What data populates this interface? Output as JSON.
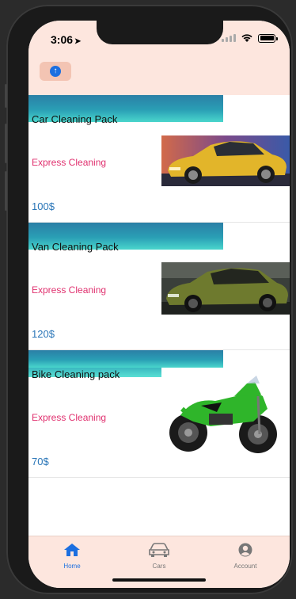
{
  "status": {
    "time": "3:06"
  },
  "packs": [
    {
      "title": "Car Cleaning Pack",
      "subtitle": "Express Cleaning",
      "price": "100$",
      "image": "yellow-car"
    },
    {
      "title": "Van Cleaning Pack",
      "subtitle": "Express Cleaning",
      "price": "120$",
      "image": "green-car"
    },
    {
      "title": "Bike Cleaning pack",
      "subtitle": "Express Cleaning",
      "price": "70$",
      "image": "green-motorbike"
    }
  ],
  "tabs": [
    {
      "label": "Home",
      "icon": "home-icon",
      "active": true
    },
    {
      "label": "Cars",
      "icon": "car-icon",
      "active": false
    },
    {
      "label": "Account",
      "icon": "account-icon",
      "active": false
    }
  ],
  "colors": {
    "topbar": "#fde6de",
    "accent": "#1c6fe0",
    "subtitle": "#e0316f",
    "price": "#2a76b8",
    "header_gradient_top": "#2b7fa6",
    "header_gradient_bottom": "#4ad6cc"
  }
}
